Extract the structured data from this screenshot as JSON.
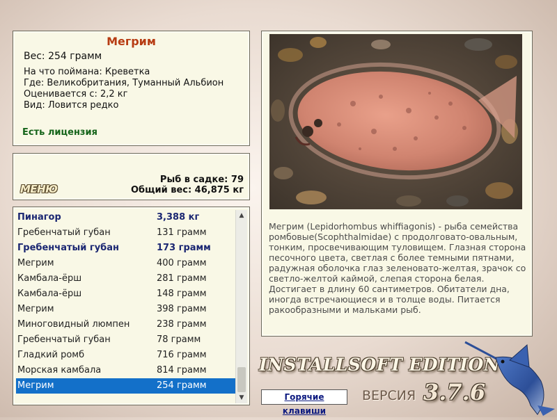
{
  "catch": {
    "title": "Мегрим",
    "weight": "Вес: 254 грамм",
    "bait": "На что поймана: Креветка",
    "location": "Где: Великобритания, Туманный Альбион",
    "value": "Оценивается с: 2,2 кг",
    "rarity": "Вид: Ловится редко",
    "license": "Есть лицензия"
  },
  "stats": {
    "menu_label": "МЕНЮ",
    "fish_count": "Рыб в садке: 79",
    "total_weight": "Общий вес: 46,875 кг"
  },
  "fish_list": [
    {
      "name": "Пинагор",
      "weight": "3,388 кг",
      "bold": true
    },
    {
      "name": "Гребенчатый губан",
      "weight": "131 грамм"
    },
    {
      "name": "Гребенчатый губан",
      "weight": "173 грамм",
      "bold": true
    },
    {
      "name": "Мегрим",
      "weight": "400 грамм"
    },
    {
      "name": "Камбала-ёрш",
      "weight": "281 грамм"
    },
    {
      "name": "Камбала-ёрш",
      "weight": "148 грамм"
    },
    {
      "name": "Мегрим",
      "weight": "398 грамм"
    },
    {
      "name": "Миноговидный люмпен",
      "weight": "238 грамм"
    },
    {
      "name": "Гребенчатый губан",
      "weight": "78 грамм"
    },
    {
      "name": "Гладкий ромб",
      "weight": "716 грамм"
    },
    {
      "name": "Морская камбала",
      "weight": "814 грамм"
    },
    {
      "name": "Мегрим",
      "weight": "254 грамм",
      "selected": true
    }
  ],
  "description": "Мегрим (Lepidorhombus whiffiagonis) - рыба семейства ромбовые(Scophthalmidae) с продолговато-овальным, тонким, просвечивающим туловищем. Глазная сторона песочного цвета, светлая с более темными пятнами, радужная оболочка глаз зеленовато-желтая, зрачок со светло-желтой каймой, слепая сторона белая. Достигает в длину 60 сантиметров. Обитатели дна, иногда встречающиеся и в толще воды. Питается ракообразными и мальками рыб.",
  "footer": {
    "hotkeys_label": "Горячие клавиши",
    "brand": "INSTALLSOFT EDITION",
    "version_label": "ВЕРСИЯ",
    "version_number": "3.7.6"
  },
  "colors": {
    "title": "#b73c13",
    "license": "#15641a",
    "bold_row": "#1b2772",
    "selection": "#1370c9",
    "panel": "#f9f8e6"
  },
  "icons": {
    "scroll_up": "triangle-up",
    "scroll_down": "triangle-down"
  }
}
